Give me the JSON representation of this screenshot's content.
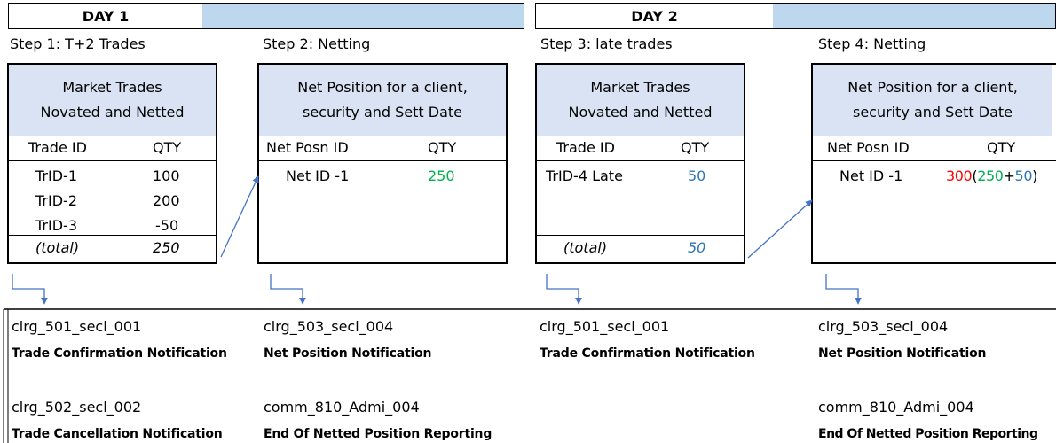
{
  "days": [
    {
      "label": "DAY 1"
    },
    {
      "label": "DAY 2"
    }
  ],
  "steps": [
    {
      "title": "Step 1: T+2 Trades",
      "header": [
        "Market Trades",
        "Novated and Netted"
      ],
      "columns": [
        "Trade ID",
        "QTY"
      ],
      "rows": [
        {
          "id": "TrID-1",
          "qty": "100"
        },
        {
          "id": "TrID-2",
          "qty": "200"
        },
        {
          "id": "TrID-3",
          "qty": "-50"
        }
      ],
      "total_label": "(total)",
      "total_value": "250"
    },
    {
      "title": "Step 2: Netting",
      "header": [
        "Net Position for a client,",
        "security and Sett Date"
      ],
      "columns": [
        "Net Posn ID",
        "QTY"
      ],
      "rows": [
        {
          "id": "Net ID -1",
          "qty": "250"
        }
      ]
    },
    {
      "title": "Step 3: late trades",
      "header": [
        "Market Trades",
        "Novated and Netted"
      ],
      "columns": [
        "Trade ID",
        "QTY"
      ],
      "rows": [
        {
          "id": "TrID-4 Late",
          "qty": "50"
        }
      ],
      "total_label": "(total)",
      "total_value": "50"
    },
    {
      "title": "Step 4: Netting",
      "header": [
        "Net Position for a client,",
        "security and Sett Date"
      ],
      "columns": [
        "Net Posn ID",
        "QTY"
      ],
      "rows": [
        {
          "id": "Net ID -1",
          "qty_parts": [
            "300",
            "(",
            "250",
            "+",
            "50",
            ")"
          ]
        }
      ]
    }
  ],
  "messages": [
    {
      "code": "clrg_501_secl_001",
      "desc": "Trade Confirmation Notification"
    },
    {
      "code": "clrg_503_secl_004",
      "desc": "Net Position Notification"
    },
    {
      "code": "clrg_501_secl_001",
      "desc": "Trade Confirmation Notification"
    },
    {
      "code": "clrg_503_secl_004",
      "desc": "Net Position Notification"
    },
    {
      "code": "clrg_502_secl_002",
      "desc": "Trade Cancellation Notification"
    },
    {
      "code": "comm_810_Admi_004",
      "desc": "End Of Netted Position Reporting"
    },
    {
      "code": "comm_810_Admi_004",
      "desc": "End Of Netted Position Reporting"
    }
  ],
  "colors": {
    "header_fill": "#dae3f3",
    "day_fill": "#bdd7ee",
    "arrow": "#4472c4",
    "green": "#00b050",
    "blue": "#2e75b6",
    "red": "#ff0000"
  }
}
